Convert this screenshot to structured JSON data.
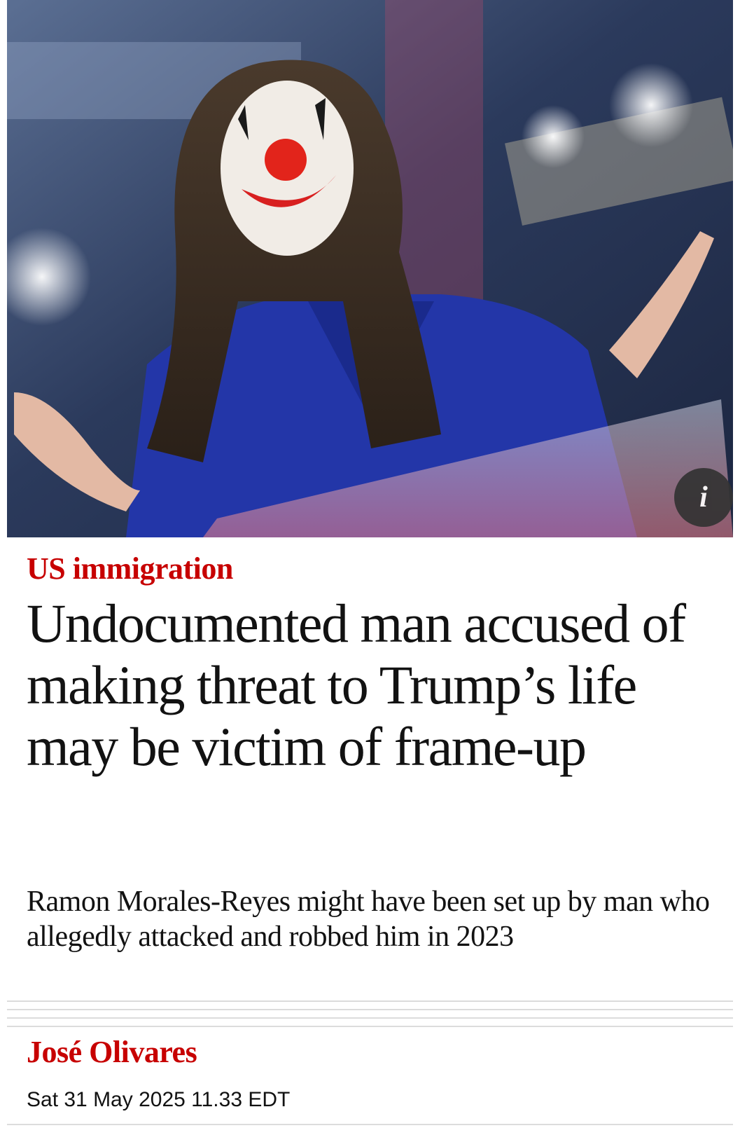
{
  "article": {
    "kicker": "US immigration",
    "headline": "Undocumented man accused of making threat to Trump’s life may be victim of frame-up",
    "standfirst": "Ramon Morales-Reyes might have been set up by man who allegedly attacked and robbed him in 2023",
    "byline": "José Olivares",
    "date": "Sat 31 May 2025 11.33 EDT"
  },
  "hero": {
    "info_label": "i",
    "info_icon": "info-icon"
  },
  "colors": {
    "accent": "#c70000",
    "text": "#121212",
    "divider": "#dcdcdc"
  }
}
